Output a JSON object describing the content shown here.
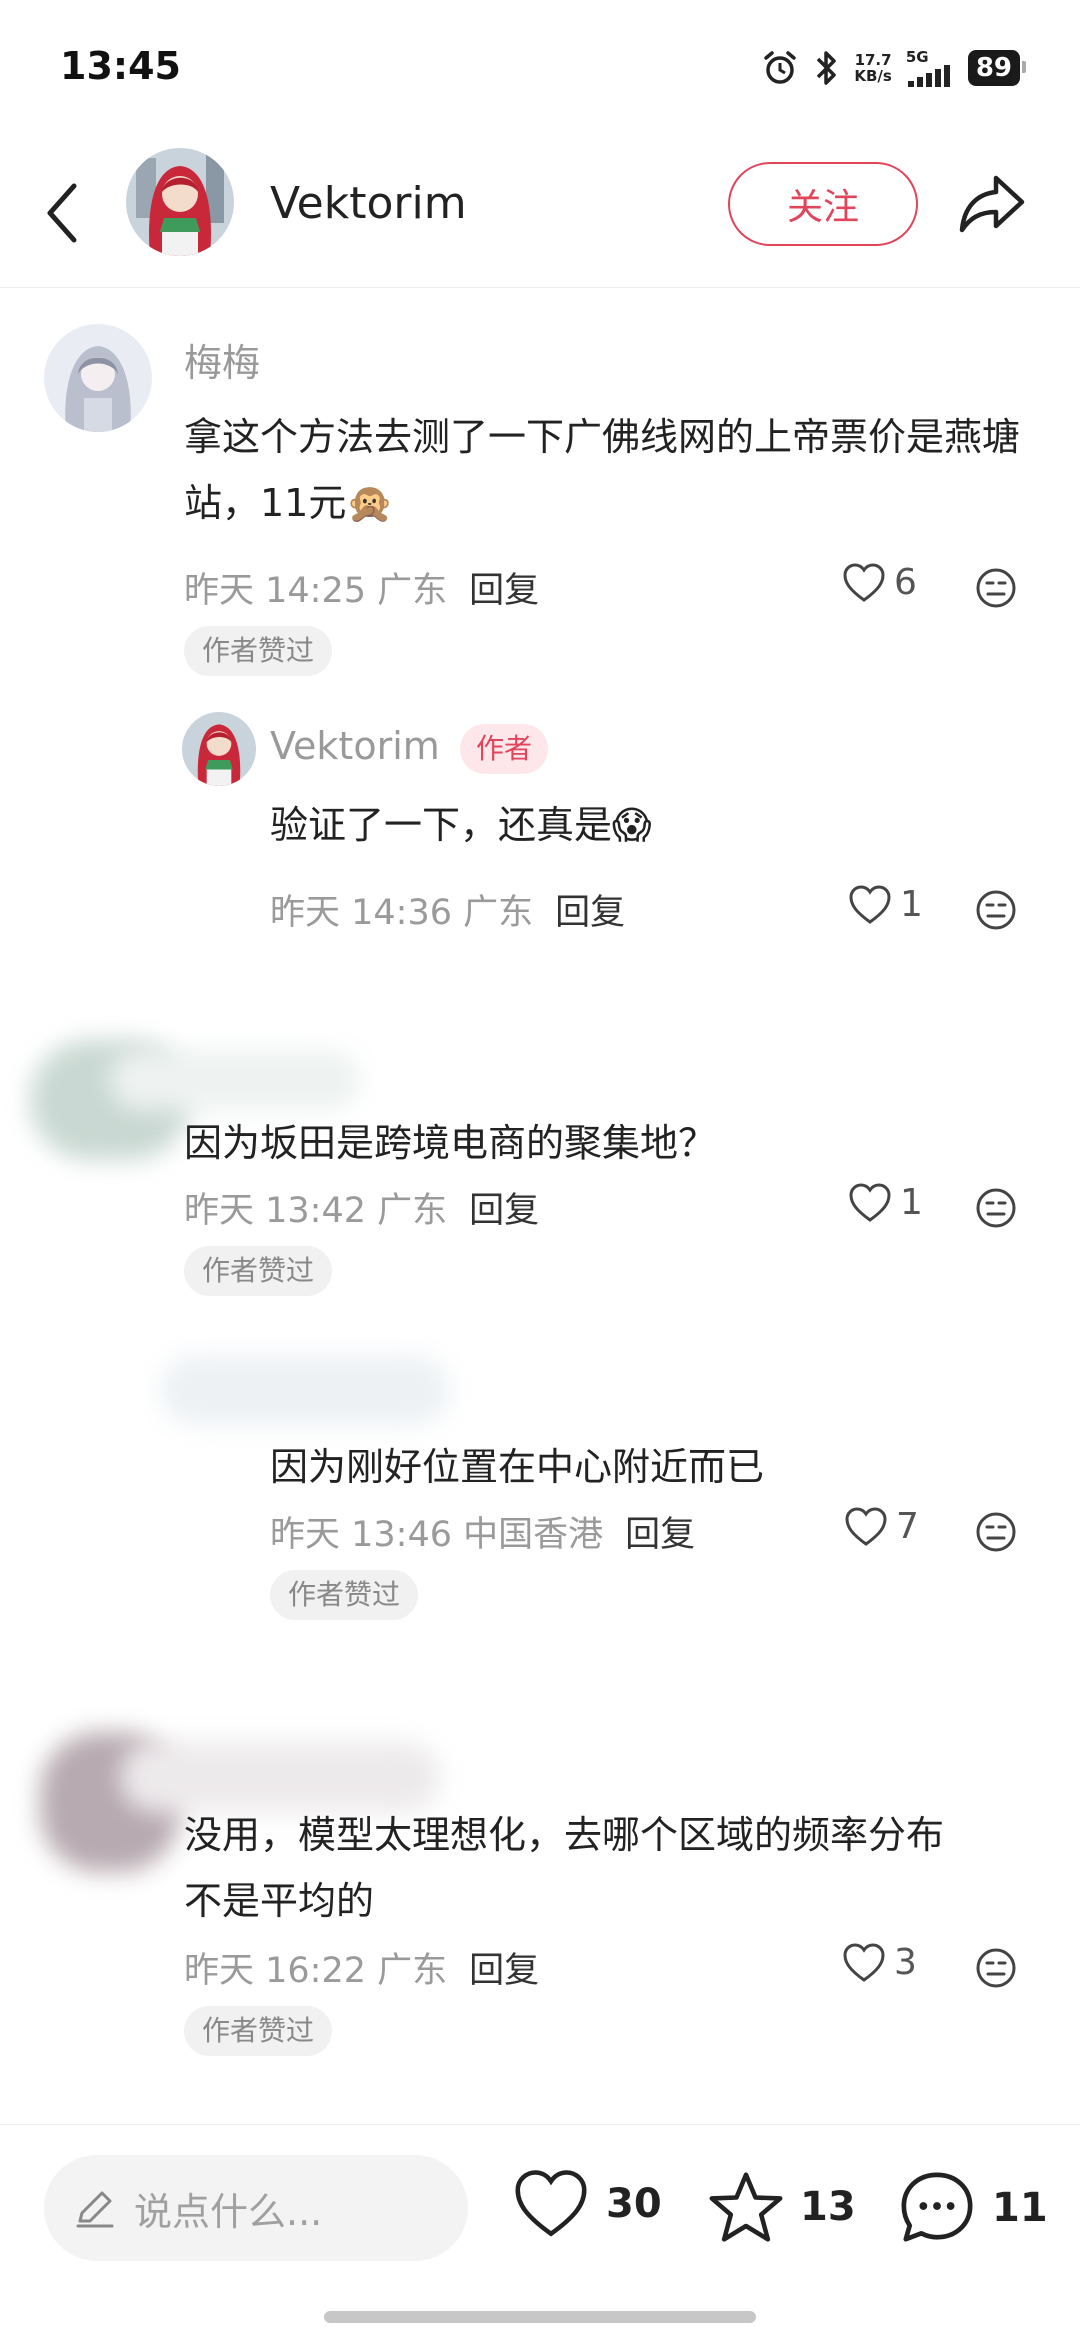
{
  "status": {
    "time": "13:45",
    "net_speed_top": "17.7",
    "net_speed_bottom": "KB/s",
    "network": "5G",
    "battery": "89"
  },
  "header": {
    "name": "Vektorim",
    "follow_label": "关注"
  },
  "comments": [
    {
      "user": "梅梅",
      "text": "拿这个方法去测了一下广佛线网的上帝票价是燕塘站，11元🙊",
      "time": "昨天 14:25 广东",
      "reply": "回复",
      "likes": "6",
      "badge": "作者赞过",
      "replies": [
        {
          "user": "Vektorim",
          "author_tag": "作者",
          "text": "验证了一下，还真是😱",
          "time": "昨天 14:36 广东",
          "reply": "回复",
          "likes": "1"
        }
      ]
    },
    {
      "user": "",
      "text": "因为坂田是跨境电商的聚集地？",
      "time": "昨天 13:42 广东",
      "reply": "回复",
      "likes": "1",
      "badge": "作者赞过",
      "replies": [
        {
          "user": "",
          "text": "因为刚好位置在中心附近而已",
          "time": "昨天 13:46 中国香港",
          "reply": "回复",
          "likes": "7",
          "badge": "作者赞过"
        }
      ]
    },
    {
      "user": "",
      "text_line1": "没用，模型太理想化，去哪个区域的频率分布",
      "text_line2": "不是平均的",
      "time": "昨天 16:22 广东",
      "reply": "回复",
      "likes": "3",
      "badge": "作者赞过"
    }
  ],
  "bottom_bar": {
    "input_placeholder": "说点什么...",
    "like_count": "30",
    "star_count": "13",
    "comment_count": "11"
  },
  "colors": {
    "accent": "#e0455b",
    "muted_text": "#9a9a9a",
    "badge_bg": "#f1f1f1"
  },
  "icons": [
    "back-icon",
    "share-icon",
    "heart-icon",
    "dislike-icon",
    "pen-icon",
    "star-icon",
    "chat-icon",
    "alarm-icon",
    "bluetooth-icon",
    "signal-icon"
  ]
}
